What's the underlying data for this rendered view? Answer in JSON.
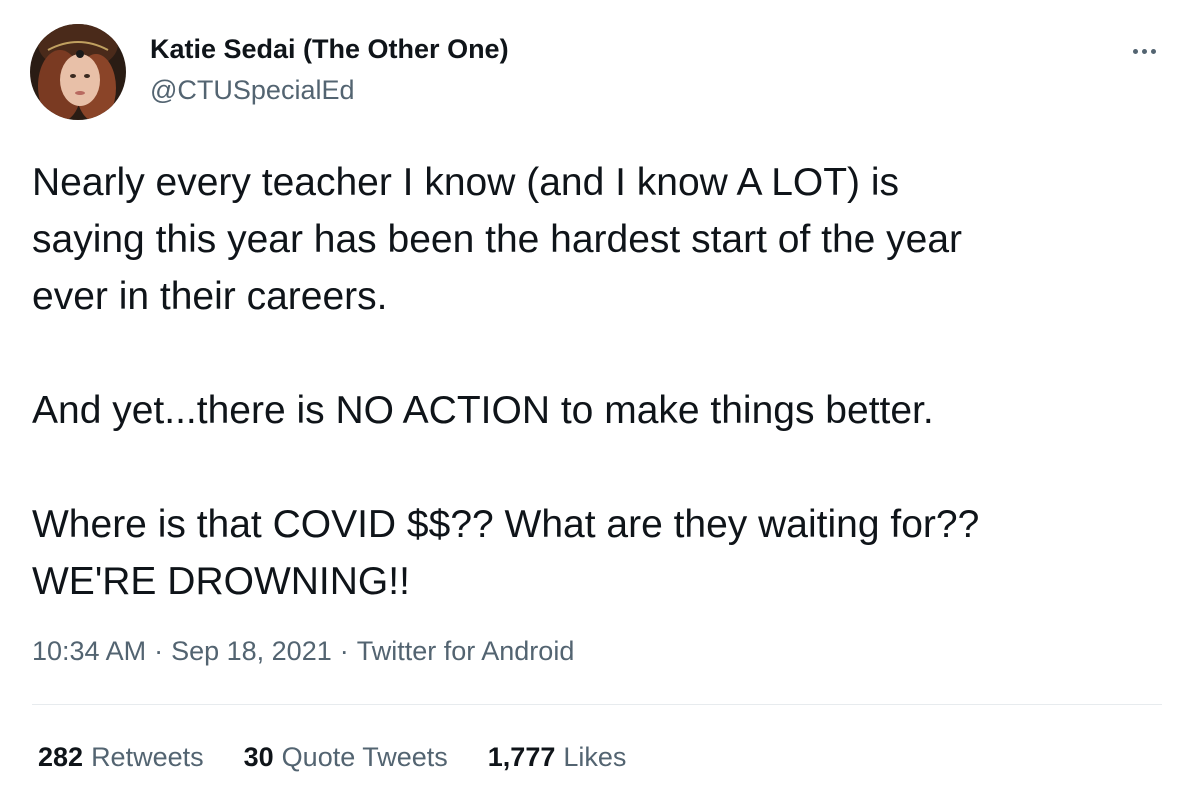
{
  "author": {
    "name": "Katie Sedai (The Other One)",
    "handle": "@CTUSpecialEd",
    "avatar_icon": "profile-photo"
  },
  "tweet": {
    "paragraphs": [
      [
        "Nearly every teacher I know (and I know A LOT) is",
        "saying this year has been the hardest start of the year",
        "ever in their careers."
      ],
      [
        "And yet...there is NO ACTION to make things better."
      ],
      [
        "Where is that COVID $$?? What are they waiting for??",
        "WE'RE DROWNING!!"
      ]
    ]
  },
  "meta": {
    "time": "10:34 AM",
    "date": "Sep 18, 2021",
    "source": "Twitter for Android",
    "separator": "·"
  },
  "stats": {
    "retweets_count": "282",
    "retweets_label": "Retweets",
    "quotes_count": "30",
    "quotes_label": "Quote Tweets",
    "likes_count": "1,777",
    "likes_label": "Likes"
  },
  "colors": {
    "text": "#0f1419",
    "secondary": "#536471",
    "divider": "#e7ebee"
  }
}
